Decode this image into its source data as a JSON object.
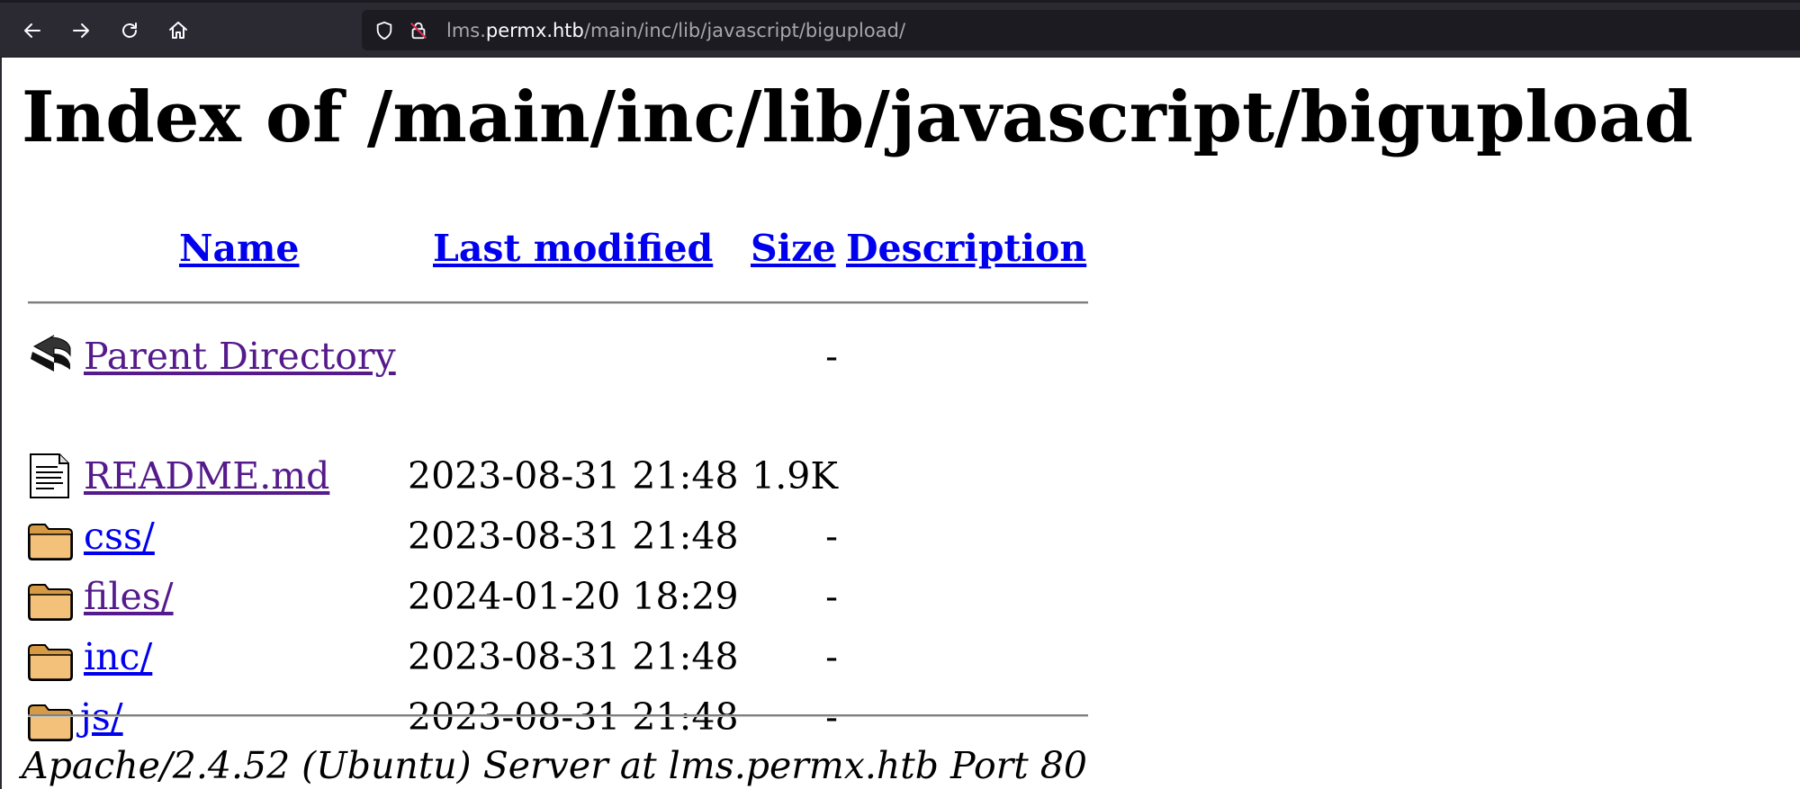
{
  "browser": {
    "url_host": "lms.permx.htb",
    "url_path": "/main/inc/lib/javascript/bigupload/",
    "url_prefix": "lms.",
    "url_domain": "permx.htb"
  },
  "page": {
    "title": "Index of /main/inc/lib/javascript/bigupload",
    "columns": {
      "name": "Name",
      "last_modified": "Last modified",
      "size": "Size",
      "description": "Description"
    },
    "rows": [
      {
        "name": "Parent Directory",
        "date": "",
        "size": "-",
        "icon": "back-arrow-icon",
        "visited": true
      },
      {
        "name": "README.md",
        "date": "2023-08-31 21:48",
        "size": "1.9K",
        "icon": "text-file-icon",
        "visited": true
      },
      {
        "name": "css/",
        "date": "2023-08-31 21:48",
        "size": "-",
        "icon": "folder-icon",
        "visited": false
      },
      {
        "name": "files/",
        "date": "2024-01-20 18:29",
        "size": "-",
        "icon": "folder-icon",
        "visited": true
      },
      {
        "name": "inc/",
        "date": "2023-08-31 21:48",
        "size": "-",
        "icon": "folder-icon",
        "visited": false
      },
      {
        "name": "js/",
        "date": "2023-08-31 21:48",
        "size": "-",
        "icon": "folder-icon",
        "visited": false
      }
    ],
    "footer": "Apache/2.4.52 (Ubuntu) Server at lms.permx.htb Port 80"
  },
  "colors": {
    "toolbar": "#2b2a33",
    "urlbar": "#1c1b22",
    "link": "#0000ee",
    "visited_link": "#551a8b"
  }
}
